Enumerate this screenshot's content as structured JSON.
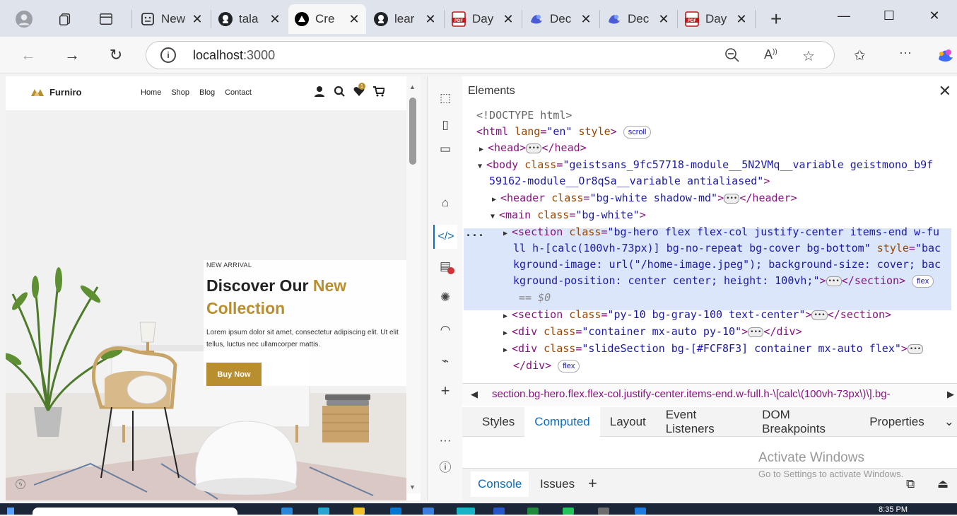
{
  "browser": {
    "tabs": [
      {
        "title": "New",
        "icon": "newtab-icon"
      },
      {
        "title": "tala",
        "icon": "github-icon"
      },
      {
        "title": "Cre",
        "icon": "nextjs-icon"
      },
      {
        "title": "lear",
        "icon": "github-icon"
      },
      {
        "title": "Day",
        "icon": "pdf-icon"
      },
      {
        "title": "Dec",
        "icon": "copilot-icon"
      },
      {
        "title": "Dec",
        "icon": "copilot-icon"
      },
      {
        "title": "Day",
        "icon": "pdf-icon"
      }
    ],
    "url_host": "localhost",
    "url_port": ":3000"
  },
  "site": {
    "brand": "Furniro",
    "nav": [
      "Home",
      "Shop",
      "Blog",
      "Contact"
    ],
    "cart_count": "1",
    "hero": {
      "kicker": "NEW ARRIVAL",
      "title_a": "Discover Our ",
      "title_b": "New",
      "title_c": "Collection",
      "body": "Lorem ipsum dolor sit amet, consectetur adipiscing elit. Ut elit tellus, luctus nec ullamcorper mattis.",
      "cta": "Buy Now"
    },
    "accent": "#B88E2F"
  },
  "devtools": {
    "panel": "Elements",
    "tree": {
      "doctype": "<!DOCTYPE html>",
      "html_open": "<html",
      "html_attr": "lang",
      "html_val": "\"en\"",
      "html_attr2": "style",
      "html_close": ">",
      "scroll_pill": "scroll",
      "head_open": "<head>",
      "head_close": "</head>",
      "body_open": "<body",
      "body_attr": "class",
      "body_val1": "\"geistsans_9fc57718-module__5N2VMq__variable geistmono_b9f",
      "body_val2": "59162-module__Or8qSa__variable antialiased\"",
      "header_open": "<header",
      "header_val": "\"bg-white shadow-md\"",
      "header_close": "</header>",
      "main_open": "<main",
      "main_val": "\"bg-white\"",
      "sec1_open": "<section",
      "sec1_class": "\"bg-hero flex flex-col justify-center items-end w-fu",
      "sec1_line2": "ll h-[calc(100vh-73px)] bg-no-repeat bg-cover bg-bottom\"",
      "sec1_style_attr": "style",
      "sec1_style_a": "\"bac",
      "sec1_line3": "kground-image: url(\"/home-image.jpeg\"); background-size: cover; bac",
      "sec1_line4": "kground-position: center center; height: 100vh;\"",
      "sec_close": "</section>",
      "flex_pill": "flex",
      "dollar0": "== $0",
      "sec2_open": "<section",
      "sec2_val": "\"py-10 bg-gray-100 text-center\"",
      "div1_open": "<div",
      "div1_val": "\"container mx-auto py-10\"",
      "div_close": "</div>",
      "div2_open": "<div",
      "div2_val": "\"slideSection bg-[#FCF8F3] container mx-auto flex\""
    },
    "breadcrumb": "section.bg-hero.flex.flex-col.justify-center.items-end.w-full.h-\\[calc\\(100vh-73px\\)\\].bg-",
    "subtabs": [
      "Styles",
      "Computed",
      "Layout",
      "Event Listeners",
      "DOM Breakpoints",
      "Properties"
    ],
    "active_subtab": "Computed",
    "drawer_tabs": [
      "Console",
      "Issues"
    ],
    "watermark_1": "Activate Windows",
    "watermark_2": "Go to Settings to activate Windows."
  },
  "taskbar": {
    "time": "8:35 PM"
  }
}
